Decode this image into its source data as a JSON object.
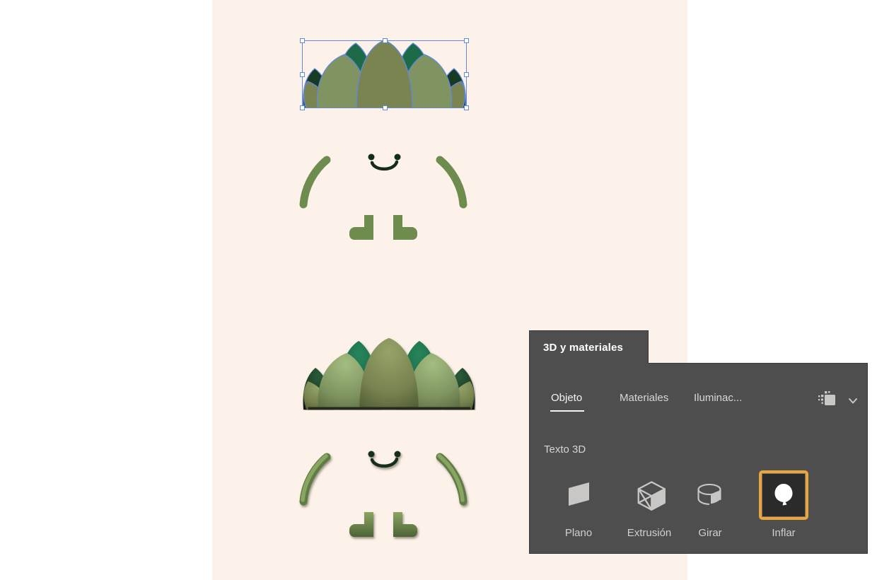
{
  "panel": {
    "title": "3D y materiales",
    "tabs": [
      {
        "label": "Objeto",
        "active": true
      },
      {
        "label": "Materiales",
        "active": false
      },
      {
        "label": "Iluminac...",
        "active": false
      }
    ],
    "header_icons": [
      "render-settings-icon",
      "chevron-down-icon"
    ],
    "section_label": "Texto 3D",
    "tools": [
      {
        "label": "Plano",
        "icon": "plane-icon",
        "selected": false
      },
      {
        "label": "Extrusión",
        "icon": "extrude-cube-icon",
        "selected": false
      },
      {
        "label": "Girar",
        "icon": "revolve-cylinder-icon",
        "selected": false
      },
      {
        "label": "Inflar",
        "icon": "inflate-balloon-icon",
        "selected": true
      }
    ]
  },
  "colors": {
    "canvas_bg": "#fdf2ea",
    "panel_bg": "#4e4e4e",
    "panel_border": "#3b3b3b",
    "panel_title": "#ffffff",
    "tab_active": "#f5f5f5",
    "tab_inactive": "#d9d7d5",
    "section_text": "#d7d4d1",
    "tool_label": "#d2cfcc",
    "icon_gray": "#c9c7c5",
    "accent_orange": "#e9a63a",
    "selected_tool_bg": "#2b2b2b",
    "selection_blue": "#6289dd",
    "handle_fill": "#ffffff",
    "leaf_olive": "#7a8450",
    "leaf_sage": "#7f9460",
    "leaf_dark": "#1d6b46",
    "leaf_darkest": "#173a22",
    "body_green": "#6d8c4e",
    "face_dark": "#132d1a"
  }
}
